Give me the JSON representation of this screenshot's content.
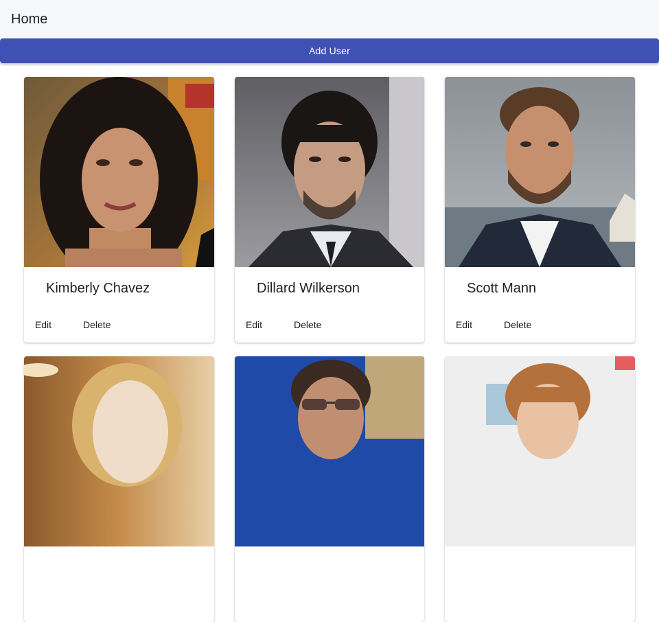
{
  "header": {
    "title": "Home"
  },
  "toolbar": {
    "add_user_label": "Add User"
  },
  "cards": [
    {
      "name": "Kimberly Chavez",
      "edit_label": "Edit",
      "delete_label": "Delete"
    },
    {
      "name": "Dillard Wilkerson",
      "edit_label": "Edit",
      "delete_label": "Delete"
    },
    {
      "name": "Scott Mann",
      "edit_label": "Edit",
      "delete_label": "Delete"
    }
  ]
}
